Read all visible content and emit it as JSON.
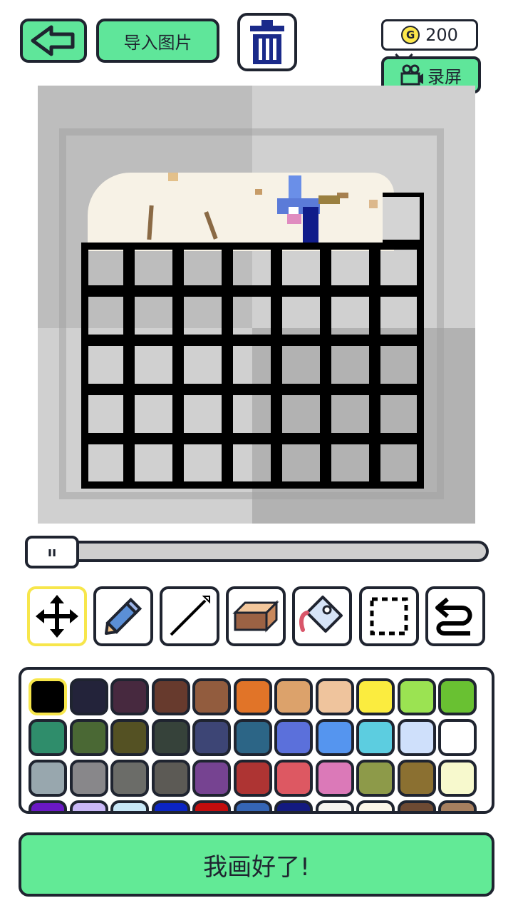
{
  "header": {
    "back_icon": "left-arrow-icon",
    "import_label": "导入图片",
    "trash_icon": "trash-icon",
    "coins": "200",
    "coin_symbol": "G",
    "record_label": "录屏",
    "record_icon": "camera-icon"
  },
  "slider": {
    "handle_label": "ıı",
    "value": 0
  },
  "tools": [
    {
      "name": "move",
      "icon": "move-arrows-icon",
      "selected": true
    },
    {
      "name": "pencil",
      "icon": "pencil-icon"
    },
    {
      "name": "line",
      "icon": "line-icon"
    },
    {
      "name": "eraser",
      "icon": "eraser-icon"
    },
    {
      "name": "fill",
      "icon": "paint-bucket-icon"
    },
    {
      "name": "select",
      "icon": "selection-icon"
    },
    {
      "name": "undo",
      "icon": "undo-icon"
    }
  ],
  "palette": {
    "colors": [
      "#000000",
      "#23233a",
      "#47293f",
      "#673a2d",
      "#925c3e",
      "#e17428",
      "#dca26b",
      "#efc49d",
      "#fbec3f",
      "#9be352",
      "#69c132",
      "#2f8d6b",
      "#4a6834",
      "#545123",
      "#36423a",
      "#3d4575",
      "#2c6586",
      "#5b70db",
      "#5595ef",
      "#5ccde0",
      "#cfe0fb",
      "#ffffff",
      "#98a7ae",
      "#88878a",
      "#6b6c68",
      "#5c5a55",
      "#764391",
      "#ae3433",
      "#dd5862",
      "#db79b8",
      "#8d9a49",
      "#8b7031",
      "#f7f9cd",
      "#6a18c4",
      "#c9b8f7",
      "#c8e7f7",
      "#0b24c4",
      "#c20d0d",
      "#3565b5",
      "#131a80",
      "#f6f4f0",
      "#fbf6e8",
      "#6d4a33",
      "#a67f5f"
    ],
    "selected_index": 0
  },
  "done_label": "我画好了!"
}
